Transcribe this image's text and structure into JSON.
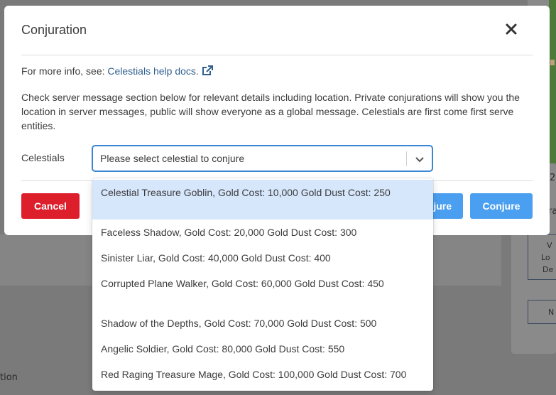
{
  "background": {
    "right_number": "2",
    "right_label": "ra",
    "right_box_1": [
      "V",
      "Lo",
      "De"
    ],
    "right_box_2": "N",
    "left_text": "tion"
  },
  "modal": {
    "title": "Conjuration",
    "close_icon": "close-icon",
    "info_prefix": "For more info, see: ",
    "info_link": "Celestials help docs.",
    "info_link_icon": "external-link-icon",
    "description": "Check server message section below for relevant details including location. Private conjurations will show you the location in server messages, public will show everyone as a global message. Celestials are first come first serve entities.",
    "field_label": "Celestials",
    "select_placeholder": "Please select celestial to conjure",
    "cancel_label": "Cancel",
    "conjure_private_label": "Conjure",
    "conjure_label": "Conjure"
  },
  "menu": {
    "options": [
      "Celestial Treasure Goblin, Gold Cost: 10,000 Gold Dust Cost: 250",
      "Faceless Shadow, Gold Cost: 20,000 Gold Dust Cost: 300",
      "Sinister Liar, Gold Cost: 40,000 Gold Dust Cost: 400",
      "Corrupted Plane Walker, Gold Cost: 60,000 Gold Dust Cost: 450",
      "Shadow of the Depths, Gold Cost: 70,000 Gold Dust Cost: 500",
      "Angelic Soldier, Gold Cost: 80,000 Gold Dust Cost: 550",
      "Red Raging Treasure Mage, Gold Cost: 100,000 Gold Dust Cost: 700"
    ],
    "active_index": 0
  },
  "colors": {
    "accent": "#4a9ff0",
    "danger": "#dc1f2b",
    "link": "#2f5f8f",
    "focus_border": "#3a86d4",
    "highlight": "#d6e6fb"
  }
}
